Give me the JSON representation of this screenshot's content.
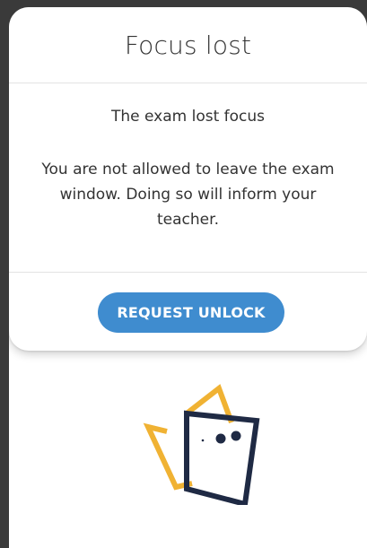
{
  "dialog": {
    "title": "Focus lost",
    "subtitle": "The exam lost focus",
    "message": "You are not allowed to leave the exam window. Doing so will inform your teacher.",
    "unlock_label": "REQUEST UNLOCK"
  },
  "colors": {
    "accent": "#3f8ccf",
    "logo_yellow": "#f0b233",
    "logo_navy": "#1f2a44"
  },
  "icons": {
    "logo": "exam-app-logo-icon"
  }
}
